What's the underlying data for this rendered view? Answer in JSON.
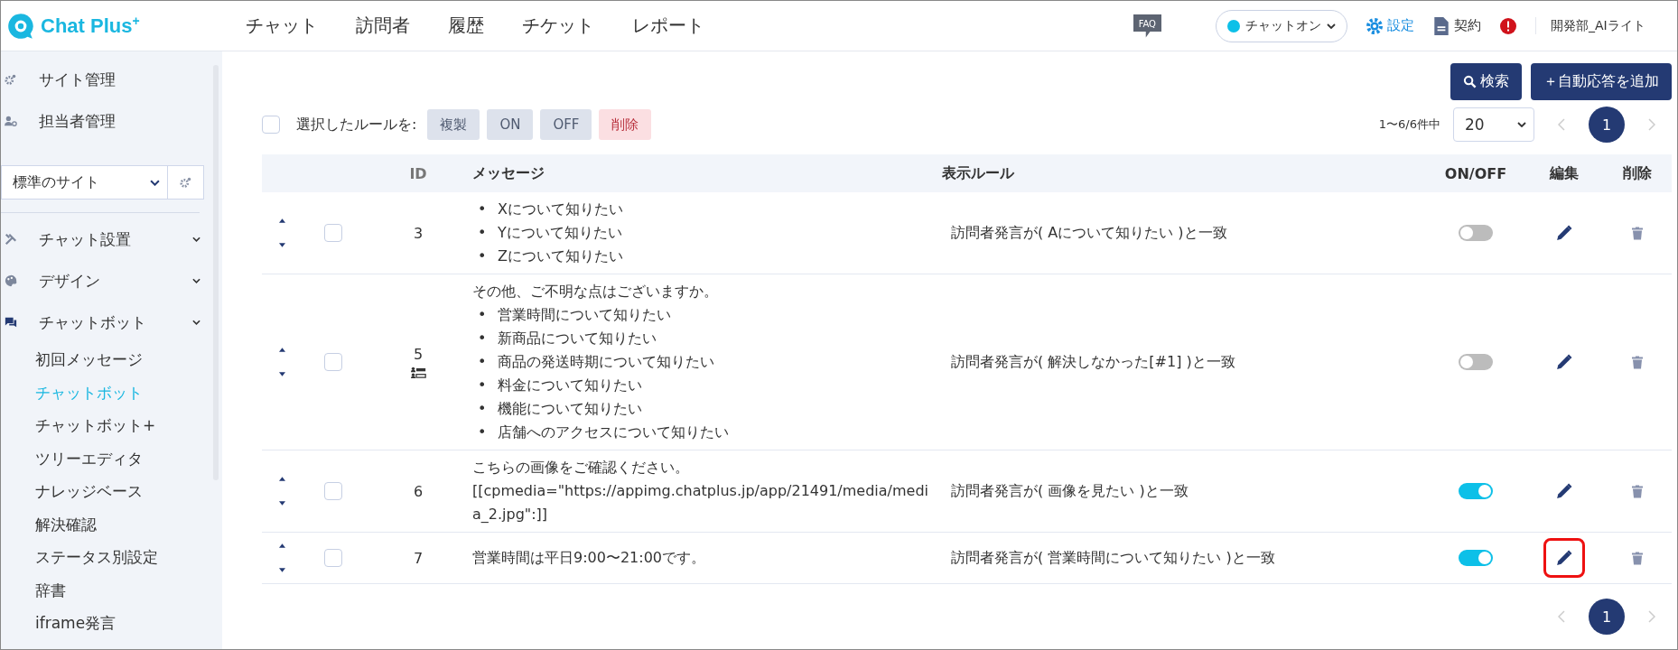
{
  "header": {
    "logo": "Chat Plus",
    "logo_sup": "+",
    "nav": [
      {
        "label": "チャット"
      },
      {
        "label": "訪問者"
      },
      {
        "label": "履歴"
      },
      {
        "label": "チケット"
      },
      {
        "label": "レポート"
      }
    ],
    "faq": "FAQ",
    "chat_status": {
      "label": "チャットオン",
      "on": true
    },
    "settings": "設定",
    "contract": "契約",
    "account": "開発部_AIライト"
  },
  "sidebar": {
    "top_items": [
      {
        "label": "サイト管理"
      },
      {
        "label": "担当者管理"
      }
    ],
    "site_select": "標準のサイト",
    "sections": [
      {
        "label": "チャット設置"
      },
      {
        "label": "デザイン"
      },
      {
        "label": "チャットボット",
        "children": [
          {
            "label": "初回メッセージ",
            "selected": false
          },
          {
            "label": "チャットボット",
            "selected": true
          },
          {
            "label": "チャットボット+",
            "selected": false
          },
          {
            "label": "ツリーエディタ",
            "selected": false
          },
          {
            "label": "ナレッジベース",
            "selected": false
          },
          {
            "label": "解決確認",
            "selected": false
          },
          {
            "label": "ステータス別設定",
            "selected": false
          },
          {
            "label": "辞書",
            "selected": false
          },
          {
            "label": "iframe発言",
            "selected": false
          }
        ]
      }
    ]
  },
  "toolbar": {
    "search_button": "検索",
    "add_button": "＋自動応答を追加",
    "select_all_checked": false,
    "bulk_label": "選択したルールを:",
    "bulk_actions": [
      {
        "label": "複製",
        "kind": "normal",
        "disabled": true
      },
      {
        "label": "ON",
        "kind": "normal",
        "disabled": true
      },
      {
        "label": "OFF",
        "kind": "normal",
        "disabled": true
      },
      {
        "label": "削除",
        "kind": "danger",
        "disabled": true
      }
    ],
    "count": "1〜6/6件中",
    "page_size": "20",
    "page": "1"
  },
  "table": {
    "columns": [
      "ID",
      "メッセージ",
      "表示ルール",
      "ON/OFF",
      "編集",
      "削除"
    ],
    "rows": [
      {
        "id": "3",
        "has_icon": false,
        "checked": false,
        "intro": "",
        "bullets": [
          {
            "marker": "•",
            "text": "Xについて知りたい"
          },
          {
            "marker": "•",
            "text": "Yについて知りたい"
          },
          {
            "marker": "•",
            "text": "Zについて知りたい"
          }
        ],
        "rule": "訪問者発言が( Aについて知りたい )と一致",
        "on": false,
        "edit_highlighted": false
      },
      {
        "id": "5",
        "has_icon": true,
        "checked": false,
        "intro": "その他、ご不明な点はございますか。",
        "bullets": [
          {
            "marker": "•",
            "text": "営業時間について知りたい"
          },
          {
            "marker": "•",
            "text": "新商品について知りたい"
          },
          {
            "marker": "•",
            "text": "商品の発送時期について知りたい"
          },
          {
            "marker": "•",
            "text": "料金について知りたい"
          },
          {
            "marker": "•",
            "text": "機能について知りたい"
          },
          {
            "marker": "•",
            "text": "店舗へのアクセスについて知りたい"
          }
        ],
        "rule": "訪問者発言が( 解決しなかった[#1] )と一致",
        "on": false,
        "edit_highlighted": false
      },
      {
        "id": "6",
        "has_icon": false,
        "checked": false,
        "intro": "こちらの画像をご確認ください。 [[cpmedia=\"https://appimg.chatplus.jp/app/21491/media/media_2.jpg\":]]",
        "bullets": [],
        "rule": "訪問者発言が( 画像を見たい )と一致",
        "on": true,
        "edit_highlighted": false
      },
      {
        "id": "7",
        "has_icon": false,
        "checked": false,
        "intro": "営業時間は平日9:00〜21:00です。",
        "bullets": [],
        "rule": "訪問者発言が( 営業時間について知りたい )と一致",
        "on": true,
        "edit_highlighted": true
      }
    ]
  },
  "bottom_page": "1"
}
